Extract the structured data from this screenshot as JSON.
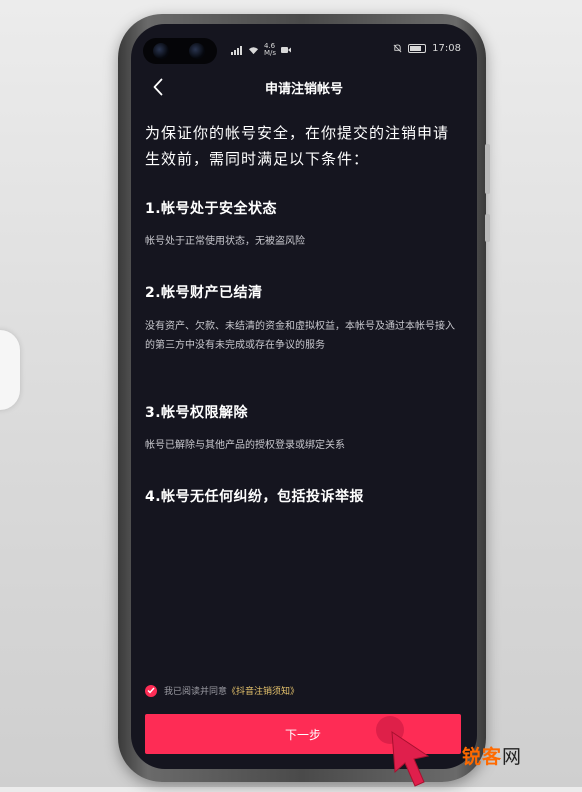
{
  "status_bar": {
    "network_speed": "4.6",
    "network_unit": "M/s",
    "time": "17:08"
  },
  "header": {
    "title": "申请注销帐号"
  },
  "intro": "为保证你的帐号安全，在你提交的注销申请生效前，需同时满足以下条件：",
  "conditions": [
    {
      "title": "1.帐号处于安全状态",
      "desc": "帐号处于正常使用状态，无被盗风险"
    },
    {
      "title": "2.帐号财产已结清",
      "desc": "没有资产、欠款、未结清的资金和虚拟权益，本帐号及通过本帐号接入的第三方中没有未完成或存在争议的服务"
    },
    {
      "title": "3.帐号权限解除",
      "desc": "帐号已解除与其他产品的授权登录或绑定关系"
    },
    {
      "title": "4.帐号无任何纠纷，包括投诉举报",
      "desc": ""
    }
  ],
  "agreement": {
    "prefix": "我已阅读并同意",
    "link": "《抖音注销须知》",
    "checked": true
  },
  "next_button": {
    "label": "下一步"
  },
  "watermark": {
    "brand": "锐客",
    "suffix": "网"
  },
  "colors": {
    "accent": "#fe2c55",
    "link": "#e7c46d",
    "screen_bg": "#15151f"
  }
}
